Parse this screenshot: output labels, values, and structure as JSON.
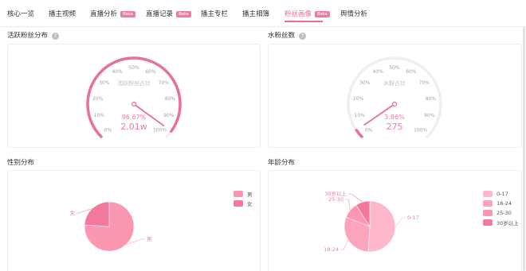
{
  "tabs": [
    {
      "label": "核心一览",
      "badge": ""
    },
    {
      "label": "播主视频",
      "badge": ""
    },
    {
      "label": "直播分析",
      "badge": "Beta"
    },
    {
      "label": "直播记录",
      "badge": "Beta"
    },
    {
      "label": "播主专栏",
      "badge": ""
    },
    {
      "label": "播主相簿",
      "badge": ""
    },
    {
      "label": "粉丝画像",
      "badge": "Beta"
    },
    {
      "label": "舆情分析",
      "badge": ""
    }
  ],
  "active_tab": "粉丝画像",
  "sections": {
    "active_fans": {
      "title": "活跃粉丝分布",
      "help": "?"
    },
    "water_fans": {
      "title": "水粉丝数",
      "help": "?"
    },
    "gender": {
      "title": "性别分布"
    },
    "age": {
      "title": "年龄分布"
    }
  },
  "gauge_ticks": [
    "0%",
    "10%",
    "20%",
    "30%",
    "40%",
    "50%",
    "60%",
    "70%",
    "80%",
    "90%",
    "100%"
  ],
  "chart_data": [
    {
      "type": "gauge",
      "title": "活跃粉丝分布",
      "inner_label": "活跃粉丝占比",
      "value_percent": 96.67,
      "value_text": "96.67%",
      "count_text": "2.01w",
      "range": [
        0,
        100
      ],
      "color": "#e8719a"
    },
    {
      "type": "gauge",
      "title": "水粉丝数",
      "inner_label": "水粉占比",
      "value_percent": 3.86,
      "value_text": "3.86%",
      "count_text": "275",
      "range": [
        0,
        100
      ],
      "color": "#e8719a"
    },
    {
      "type": "pie",
      "title": "性别分布",
      "categories": [
        "男",
        "女"
      ],
      "values": [
        76,
        24
      ],
      "colors": [
        "#fc97b2",
        "#f4789b"
      ],
      "legend_position": "right"
    },
    {
      "type": "pie",
      "title": "年龄分布",
      "categories": [
        "0-17",
        "18-24",
        "25-30",
        "30岁以上"
      ],
      "values": [
        51,
        30,
        10,
        9
      ],
      "colors": [
        "#ffb8cb",
        "#fca4bd",
        "#fc97b2",
        "#f4789b"
      ],
      "legend_position": "right"
    }
  ],
  "colors": {
    "accent": "#ea6d94",
    "gauge_track": "#efefef",
    "border": "#eeeeee"
  }
}
